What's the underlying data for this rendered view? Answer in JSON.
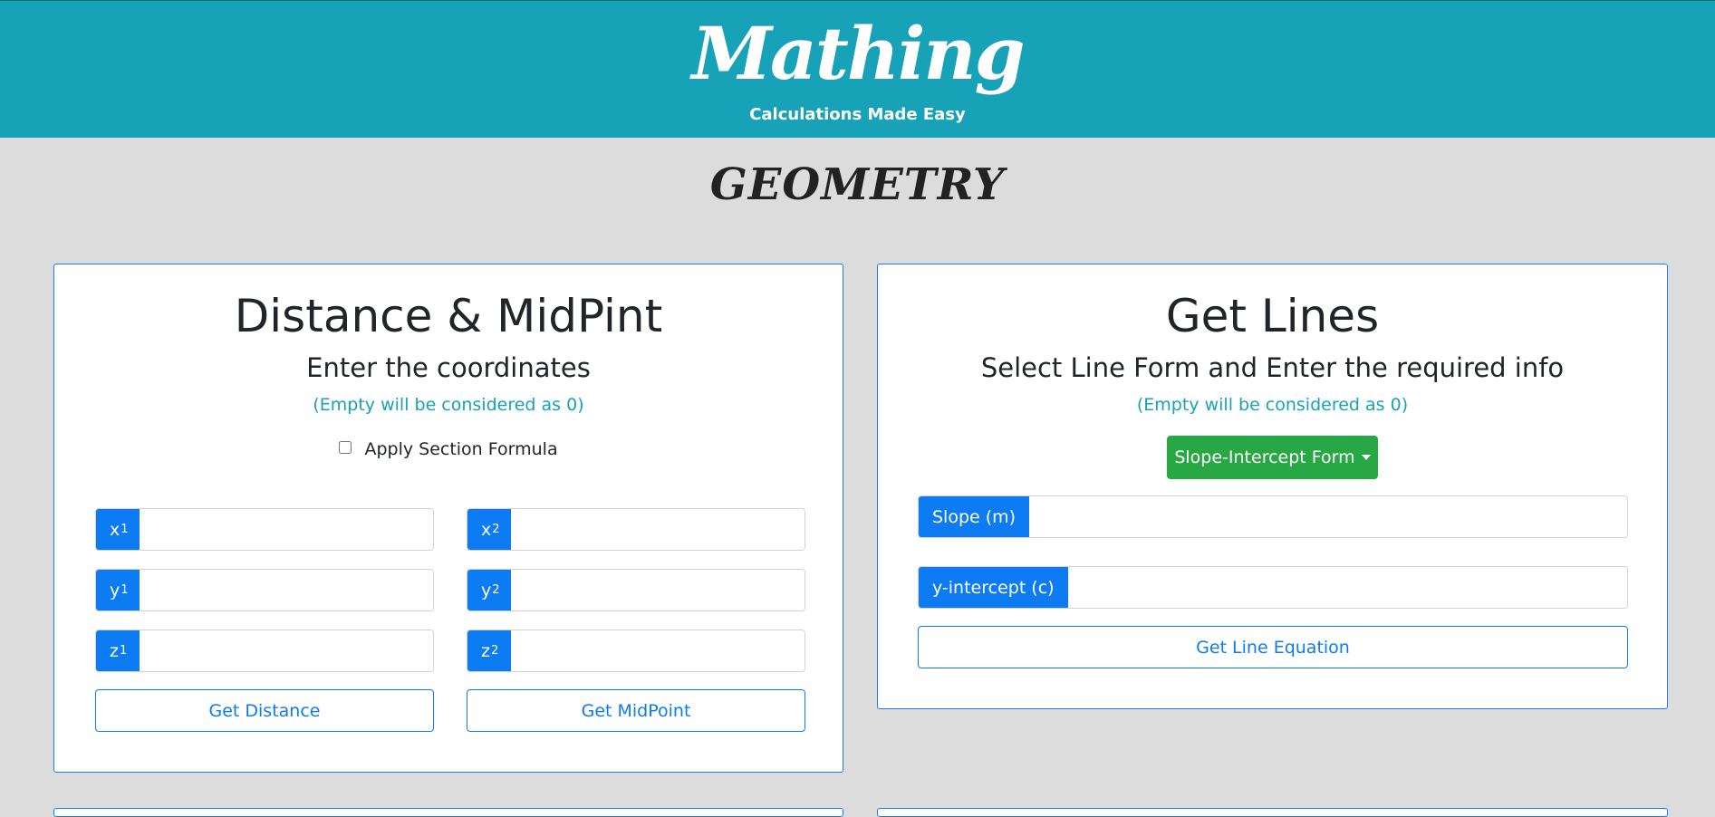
{
  "header": {
    "brand": "Mathing",
    "tagline": "Calculations Made Easy"
  },
  "page": {
    "title": "GEOMETRY"
  },
  "distance_card": {
    "title": "Distance & MidPint",
    "subtitle": "Enter the coordinates",
    "note": "(Empty will be considered as 0)",
    "section_formula_label": "Apply Section Formula",
    "section_formula_checked": false,
    "fields": {
      "x1": {
        "var": "x",
        "sub": "1",
        "value": ""
      },
      "y1": {
        "var": "y",
        "sub": "1",
        "value": ""
      },
      "z1": {
        "var": "z",
        "sub": "1",
        "value": ""
      },
      "x2": {
        "var": "x",
        "sub": "2",
        "value": ""
      },
      "y2": {
        "var": "y",
        "sub": "2",
        "value": ""
      },
      "z2": {
        "var": "z",
        "sub": "2",
        "value": ""
      }
    },
    "distance_button": "Get Distance",
    "midpoint_button": "Get MidPoint"
  },
  "lines_card": {
    "title": "Get Lines",
    "subtitle": "Select Line Form and Enter the required info",
    "note": "(Empty will be considered as 0)",
    "form_dropdown": "Slope-Intercept Form",
    "slope_label": "Slope (m)",
    "slope_value": "",
    "intercept_label": "y-intercept (c)",
    "intercept_value": "",
    "equation_button": "Get Line Equation"
  },
  "colors": {
    "header_bg": "#17a2b8",
    "page_bg": "#dcdcdc",
    "primary": "#0d7bf2",
    "success": "#28a745",
    "info_text": "#17a2b8"
  }
}
